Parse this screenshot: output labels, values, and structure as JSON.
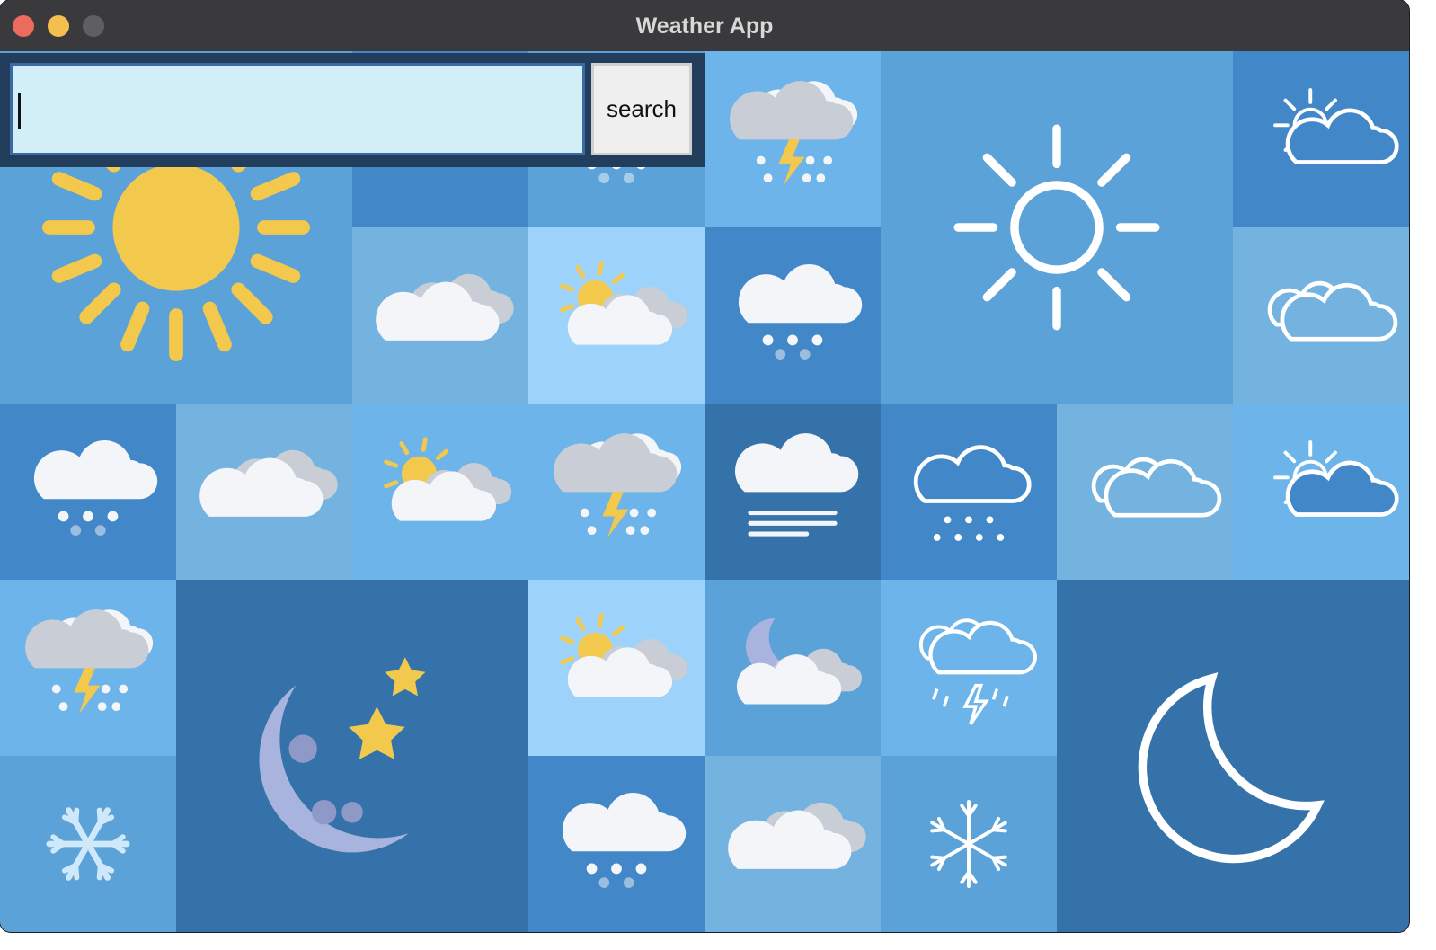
{
  "window": {
    "title": "Weather App",
    "traffic_lights": [
      {
        "name": "close",
        "color": "#ec6a5e"
      },
      {
        "name": "minimize",
        "color": "#f4bf4f"
      },
      {
        "name": "zoom",
        "color": "#5f5f62"
      }
    ]
  },
  "search": {
    "value": "",
    "button_label": "search"
  },
  "colors": {
    "tile_blue_1": "#5aa2d8",
    "tile_blue_2": "#4287c7",
    "tile_blue_3": "#74b2e0",
    "tile_blue_4": "#9dd3fa",
    "tile_blue_5": "#3572a9",
    "tile_blue_6": "#6cb4ea",
    "sun_yellow": "#f2c94c",
    "cloud_white": "#f3f5f8",
    "cloud_grey": "#c9ced6",
    "moon_lilac": "#a9b4de"
  },
  "tiles": [
    {
      "icon": "sun-icon"
    },
    {
      "icon": "cloud-icon"
    },
    {
      "icon": "snow-cloud-icon"
    },
    {
      "icon": "thunderstorm-icon"
    },
    {
      "icon": "sun-outline-icon"
    },
    {
      "icon": "partly-cloudy-outline-icon"
    },
    {
      "icon": "cloudy-icon"
    },
    {
      "icon": "partly-sunny-icon"
    },
    {
      "icon": "snow-cloud-icon"
    },
    {
      "icon": "cloudy-outline-icon"
    },
    {
      "icon": "snow-cloud-icon"
    },
    {
      "icon": "cloudy-icon"
    },
    {
      "icon": "partly-sunny-icon"
    },
    {
      "icon": "thunderstorm-icon"
    },
    {
      "icon": "fog-icon"
    },
    {
      "icon": "snow-cloud-outline-icon"
    },
    {
      "icon": "cloudy-outline-icon"
    },
    {
      "icon": "partly-cloudy-outline-icon"
    },
    {
      "icon": "thunderstorm-icon"
    },
    {
      "icon": "moon-stars-icon"
    },
    {
      "icon": "partly-sunny-icon"
    },
    {
      "icon": "night-cloudy-icon"
    },
    {
      "icon": "thunderstorm-outline-icon"
    },
    {
      "icon": "moon-outline-icon"
    },
    {
      "icon": "snowflake-icon"
    },
    {
      "icon": "snow-cloud-icon"
    },
    {
      "icon": "cloudy-icon"
    },
    {
      "icon": "snowflake-outline-icon"
    }
  ]
}
